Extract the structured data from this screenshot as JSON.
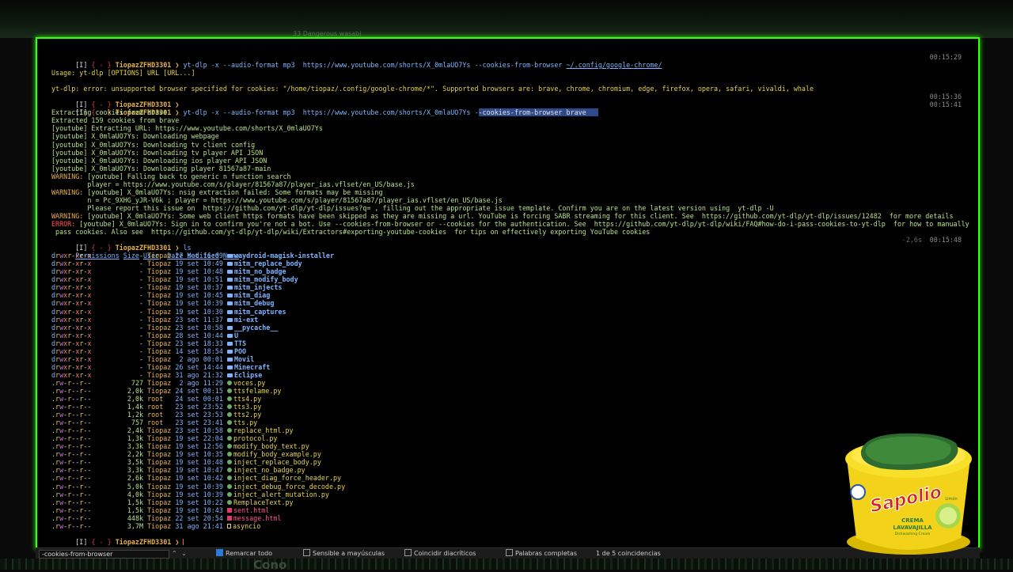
{
  "bg_top_text": "33 Dangerous wasabi",
  "bg_bottom_word": "Cono",
  "terminal": {
    "prompt_user": "TiopazZFHD3301",
    "cmd1": "yt-dlp -x --audio-format mp3  https://www.youtube.com/shorts/X_0mlaUO7Ys --cookies-from-browser ",
    "cmd1_path": "~/.config/google-chrome/",
    "ts1": "00:15:29",
    "usage": "Usage: yt-dlp [OPTIONS] URL [URL...]",
    "error1": "yt-dlp: error: unsupported browser specified for cookies: \"/home/tiopaz/.config/google-chrome/*\". Supported browsers are: brave, chrome, chromium, edge, firefox, opera, safari, vivaldi, whale",
    "ts2": "00:15:36",
    "cmd2_a": "yt-dlp -x --audio-format mp3  https://www.youtube.com/shorts/X_0mlaUO7Ys -",
    "cmd2_sel": "-cookies-from-browser brave   ",
    "ts3": "00:15:41",
    "log": [
      {
        "cls": "g",
        "t": "Extracting cookies from brave"
      },
      {
        "cls": "g",
        "t": "Extracted 159 cookies from brave"
      },
      {
        "cls": "g",
        "t": "[youtube] Extracting URL: https://www.youtube.com/shorts/X_0mlaUO7Ys"
      },
      {
        "cls": "g",
        "t": "[youtube] X_0mlaUO7Ys: Downloading webpage"
      },
      {
        "cls": "g",
        "t": "[youtube] X_0mlaUO7Ys: Downloading tv client config"
      },
      {
        "cls": "g",
        "t": "[youtube] X_0mlaUO7Ys: Downloading tv player API JSON"
      },
      {
        "cls": "g",
        "t": "[youtube] X_0mlaUO7Ys: Downloading ios player API JSON"
      },
      {
        "cls": "g",
        "t": "[youtube] X_0mlaUO7Ys: Downloading player 81567a87-main"
      }
    ],
    "warn1_tag": "WARNING:",
    "warn1": " [youtube] Falling back to generic n function search",
    "warn1b": "         player = https://www.youtube.com/s/player/81567a87/player_ias.vflset/en_US/base.js",
    "warn2_tag": "WARNING:",
    "warn2": " [youtube] X_0mlaUO7Ys: nsig extraction failed: Some formats may be missing",
    "warn2b": "         n = Pc_9XHG_yJR-V6k ; player = https://www.youtube.com/s/player/81567a87/player_ias.vflset/en_US/base.js",
    "warn2c": "         Please report this issue on  https://github.com/yt-dlp/yt-dlp/issues?q= , filling out the appropriate issue template. Confirm you are on the latest version using  yt-dlp -U",
    "warn3_tag": "WARNING:",
    "warn3": " [youtube] X_0mlaUO7Ys: Some web client https formats have been skipped as they are missing a url. YouTube is forcing SABR streaming for this client. See  https://github.com/yt-dlp/yt-dlp/issues/12482  for more details",
    "err_tag": "ERROR:",
    "err": " [youtube] X_0mlaUO7Ys: Sign in to confirm you're not a bot. Use --cookies-from-browser or --cookies for the authentication. See  https://github.com/yt-dlp/yt-dlp/wiki/FAQ#how-do-i-pass-cookies-to-yt-dlp  for how to manually",
    "err2": " pass cookies. Also see  https://github.com/yt-dlp/yt-dlp/wiki/Extractors#exporting-youtube-cookies  for tips on effectively exporting YouTube cookies",
    "cmd3": "ls",
    "ts4_dim": "-2,6s",
    "ts4": "00:15:48",
    "headers": {
      "perm": "Permissions",
      "size": "Size",
      "user": "User",
      "date": "Date Modified",
      "name": "Name"
    },
    "rows": [
      {
        "p": "drwxr-xr-x",
        "s": "-",
        "u": "Tiopaz",
        "d": "27 set 16:09",
        "n": "waydroid-magisk-installer",
        "k": "dir"
      },
      {
        "p": "drwxr-xr-x",
        "s": "-",
        "u": "Tiopaz",
        "d": "19 set 10:49",
        "n": "mitm_replace_body",
        "k": "dir"
      },
      {
        "p": "drwxr-xr-x",
        "s": "-",
        "u": "Tiopaz",
        "d": "19 set 10:48",
        "n": "mitm_no_badge",
        "k": "dir"
      },
      {
        "p": "drwxr-xr-x",
        "s": "-",
        "u": "Tiopaz",
        "d": "19 set 10:51",
        "n": "mitm_modify_body",
        "k": "dir"
      },
      {
        "p": "drwxr-xr-x",
        "s": "-",
        "u": "Tiopaz",
        "d": "19 set 10:37",
        "n": "mitm_injects",
        "k": "dir"
      },
      {
        "p": "drwxr-xr-x",
        "s": "-",
        "u": "Tiopaz",
        "d": "19 set 10:45",
        "n": "mitm_diag",
        "k": "dir"
      },
      {
        "p": "drwxr-xr-x",
        "s": "-",
        "u": "Tiopaz",
        "d": "19 set 10:39",
        "n": "mitm_debug",
        "k": "dir"
      },
      {
        "p": "drwxr-xr-x",
        "s": "-",
        "u": "Tiopaz",
        "d": "19 set 10:30",
        "n": "mitm_captures",
        "k": "dir"
      },
      {
        "p": "drwxr-xr-x",
        "s": "-",
        "u": "Tiopaz",
        "d": "23 set 11:37",
        "n": "mi-ext",
        "k": "dir"
      },
      {
        "p": "drwxr-xr-x",
        "s": "-",
        "u": "Tiopaz",
        "d": "23 set 10:58",
        "n": "__pycache__",
        "k": "dir"
      },
      {
        "p": "drwxr-xr-x",
        "s": "-",
        "u": "Tiopaz",
        "d": "28 set 10:44",
        "n": "U",
        "k": "dir"
      },
      {
        "p": "drwxr-xr-x",
        "s": "-",
        "u": "Tiopaz",
        "d": "23 set 18:33",
        "n": "TTS",
        "k": "dir"
      },
      {
        "p": "drwxr-xr-x",
        "s": "-",
        "u": "Tiopaz",
        "d": "14 set 18:54",
        "n": "POO",
        "k": "dir"
      },
      {
        "p": "drwxr-xr-x",
        "s": "-",
        "u": "Tiopaz",
        "d": "2 ago 00:01",
        "n": "Movil",
        "k": "dir"
      },
      {
        "p": "drwxr-xr-x",
        "s": "-",
        "u": "Tiopaz",
        "d": "26 set 14:44",
        "n": "Minecraft",
        "k": "dir"
      },
      {
        "p": "drwxr-xr-x",
        "s": "-",
        "u": "Tiopaz",
        "d": "31 ago 21:32",
        "n": "Eclipse",
        "k": "dir"
      },
      {
        "p": ".rw-r--r--",
        "s": "727",
        "u": "Tiopaz",
        "d": "2 ago 11:29",
        "n": "voces.py",
        "k": "py"
      },
      {
        "p": ".rw-r--r--",
        "s": "2,0k",
        "u": "Tiopaz",
        "d": "24 set 00:15",
        "n": "ttsfelame.py",
        "k": "py"
      },
      {
        "p": ".rw-r--r--",
        "s": "2,0k",
        "u": "root",
        "d": "24 set 00:01",
        "n": "tts4.py",
        "k": "py"
      },
      {
        "p": ".rw-r--r--",
        "s": "1,4k",
        "u": "root",
        "d": "23 set 23:52",
        "n": "tts3.py",
        "k": "py"
      },
      {
        "p": ".rw-r--r--",
        "s": "1,2k",
        "u": "root",
        "d": "23 set 23:53",
        "n": "tts2.py",
        "k": "py"
      },
      {
        "p": ".rw-r--r--",
        "s": "757",
        "u": "root",
        "d": "23 set 23:41",
        "n": "tts.py",
        "k": "py"
      },
      {
        "p": ".rw-r--r--",
        "s": "2,4k",
        "u": "Tiopaz",
        "d": "23 set 10:58",
        "n": "replace_html.py",
        "k": "py"
      },
      {
        "p": ".rw-r--r--",
        "s": "1,3k",
        "u": "Tiopaz",
        "d": "19 set 22:04",
        "n": "protocol.py",
        "k": "py"
      },
      {
        "p": ".rw-r--r--",
        "s": "3,3k",
        "u": "Tiopaz",
        "d": "19 set 12:56",
        "n": "modify_body_text.py",
        "k": "py"
      },
      {
        "p": ".rw-r--r--",
        "s": "2,2k",
        "u": "Tiopaz",
        "d": "19 set 10:35",
        "n": "modify_body_example.py",
        "k": "py"
      },
      {
        "p": ".rw-r--r--",
        "s": "3,5k",
        "u": "Tiopaz",
        "d": "19 set 10:48",
        "n": "inject_replace_body.py",
        "k": "py"
      },
      {
        "p": ".rw-r--r--",
        "s": "3,3k",
        "u": "Tiopaz",
        "d": "19 set 10:47",
        "n": "inject_no_badge.py",
        "k": "py"
      },
      {
        "p": ".rw-r--r--",
        "s": "2,6k",
        "u": "Tiopaz",
        "d": "19 set 10:42",
        "n": "inject_diag_force_header.py",
        "k": "py"
      },
      {
        "p": ".rw-r--r--",
        "s": "5,0k",
        "u": "Tiopaz",
        "d": "19 set 10:39",
        "n": "inject_debug_force_decode.py",
        "k": "py"
      },
      {
        "p": ".rw-r--r--",
        "s": "4,0k",
        "u": "Tiopaz",
        "d": "19 set 10:39",
        "n": "inject_alert_mutation.py",
        "k": "py"
      },
      {
        "p": ".rw-r--r--",
        "s": "1,5k",
        "u": "Tiopaz",
        "d": "19 set 10:22",
        "n": "RemplaceText.py",
        "k": "py"
      },
      {
        "p": ".rw-r--r--",
        "s": "1,5k",
        "u": "Tiopaz",
        "d": "19 set 10:43",
        "n": "sent.html",
        "k": "html"
      },
      {
        "p": ".rw-r--r--",
        "s": "448k",
        "u": "Tiopaz",
        "d": "22 set 20:54",
        "n": "message.html",
        "k": "html"
      },
      {
        "p": ".rw-r--r--",
        "s": "3,7M",
        "u": "Tiopaz",
        "d": "31 ago 21:41",
        "n": "asyncio",
        "k": "file"
      }
    ]
  },
  "search": {
    "value": "-cookies-from-browser",
    "options": [
      {
        "label": "Remarcar todo",
        "checked": true
      },
      {
        "label": "Sensible a mayúsculas",
        "checked": false
      },
      {
        "label": "Coincidir diacríticos",
        "checked": false
      },
      {
        "label": "Palabras completas",
        "checked": false
      }
    ],
    "matches": "1 de 5 coincidencias"
  },
  "product": {
    "brand": "Sapolio",
    "line1": "CREMA",
    "line2": "LAVAVAJILLA",
    "line3": "Dishwashing Cream",
    "flavor": "Limón"
  },
  "colors": {
    "accent": "#39ff14",
    "prompt_user": "#e8b24a",
    "dir": "#7fb3ff",
    "error": "#ff5555"
  }
}
